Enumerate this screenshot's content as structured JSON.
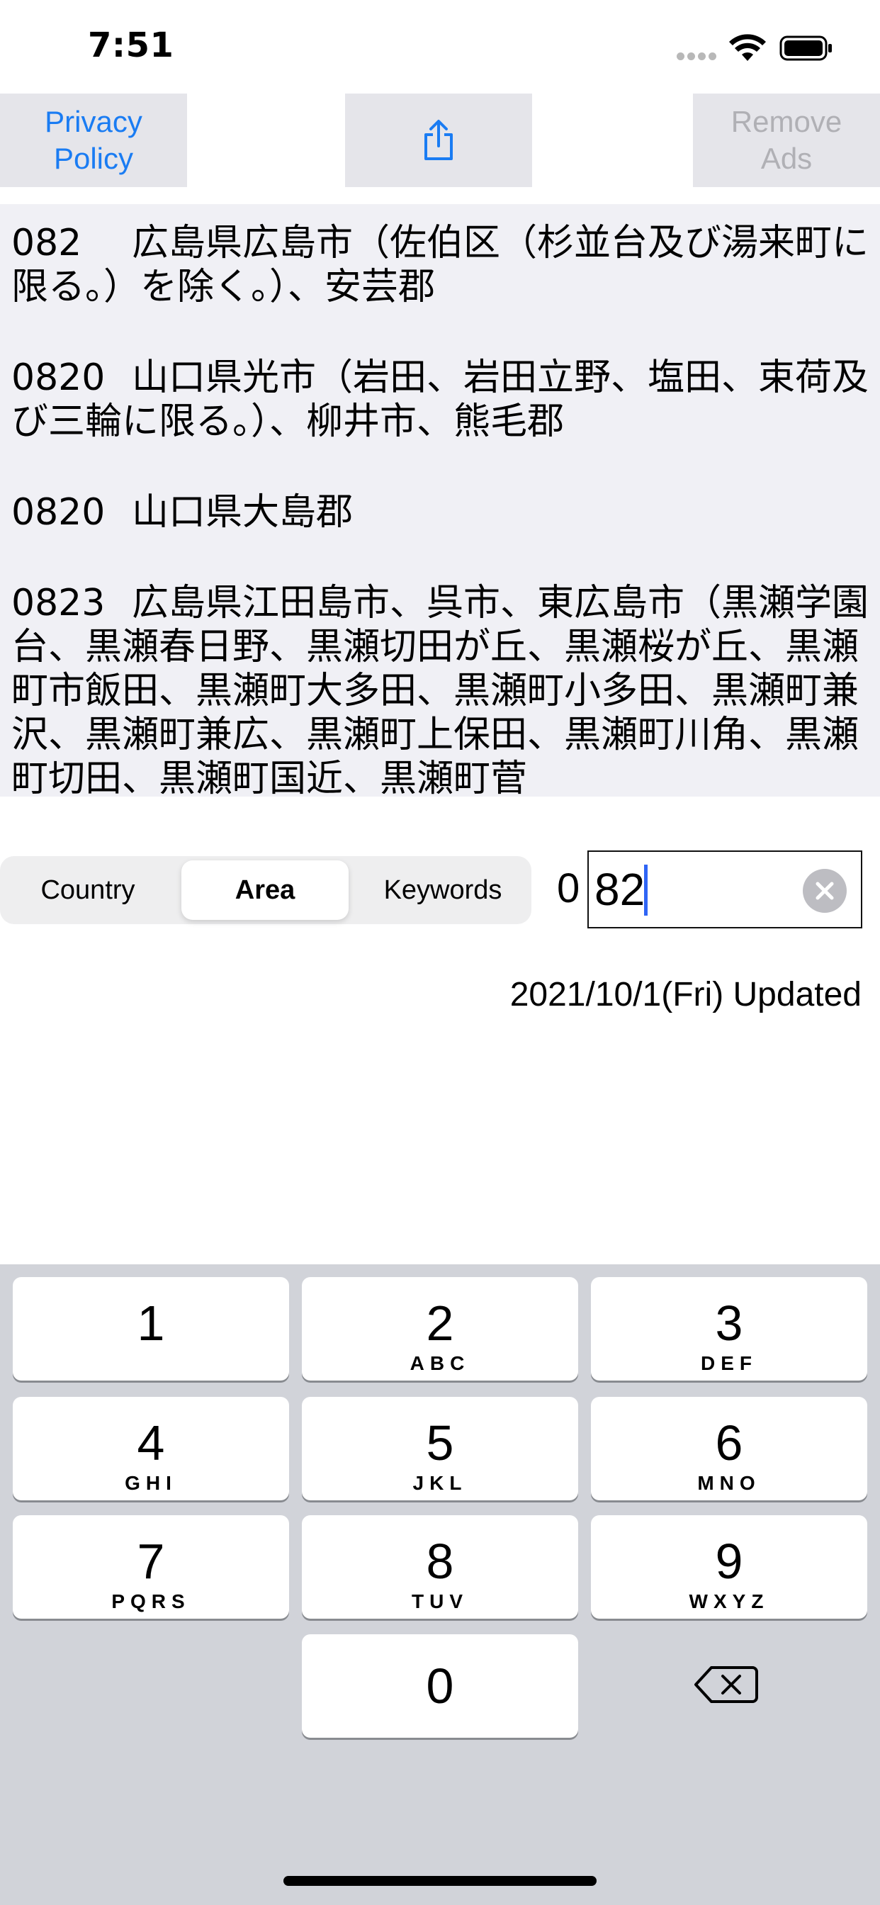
{
  "status_bar": {
    "time": "7:51"
  },
  "toolbar": {
    "privacy_label": "Privacy\nPolicy",
    "share_icon": "share-icon",
    "remove_ads_label": "Remove\nAds"
  },
  "results": [
    {
      "code": "082",
      "text": "広島県広島市（佐伯区（杉並台及び湯来町に限る。）を除く。）、安芸郡"
    },
    {
      "code": "0820",
      "text": "山口県光市（岩田、岩田立野、塩田、束荷及び三輪に限る。）、柳井市、熊毛郡"
    },
    {
      "code": "0820",
      "text": "山口県大島郡"
    },
    {
      "code": "0823",
      "text": "広島県江田島市、呉市、東広島市（黒瀬学園台、黒瀬春日野、黒瀬切田が丘、黒瀬桜が丘、黒瀬町市飯田、黒瀬町大多田、黒瀬町小多田、黒瀬町兼沢、黒瀬町兼広、黒瀬町上保田、黒瀬町川角、黒瀬町切田、黒瀬町国近、黒瀬町菅"
    }
  ],
  "segments": {
    "country": "Country",
    "area": "Area",
    "keywords": "Keywords",
    "selected": "Area"
  },
  "search": {
    "prefix": "0",
    "value": "82"
  },
  "updated": "2021/10/1(Fri) Updated",
  "keyboard": {
    "keys": [
      {
        "num": "1",
        "letters": ""
      },
      {
        "num": "2",
        "letters": "ABC"
      },
      {
        "num": "3",
        "letters": "DEF"
      },
      {
        "num": "4",
        "letters": "GHI"
      },
      {
        "num": "5",
        "letters": "JKL"
      },
      {
        "num": "6",
        "letters": "MNO"
      },
      {
        "num": "7",
        "letters": "PQRS"
      },
      {
        "num": "8",
        "letters": "TUV"
      },
      {
        "num": "9",
        "letters": "WXYZ"
      },
      {
        "num": "0",
        "letters": ""
      }
    ],
    "delete_icon": "backspace-icon"
  },
  "colors": {
    "accent": "#1a7cf3",
    "disabled": "#b0b0b5",
    "caret": "#2f65f5",
    "keyboard_bg": "#d1d3d9"
  }
}
